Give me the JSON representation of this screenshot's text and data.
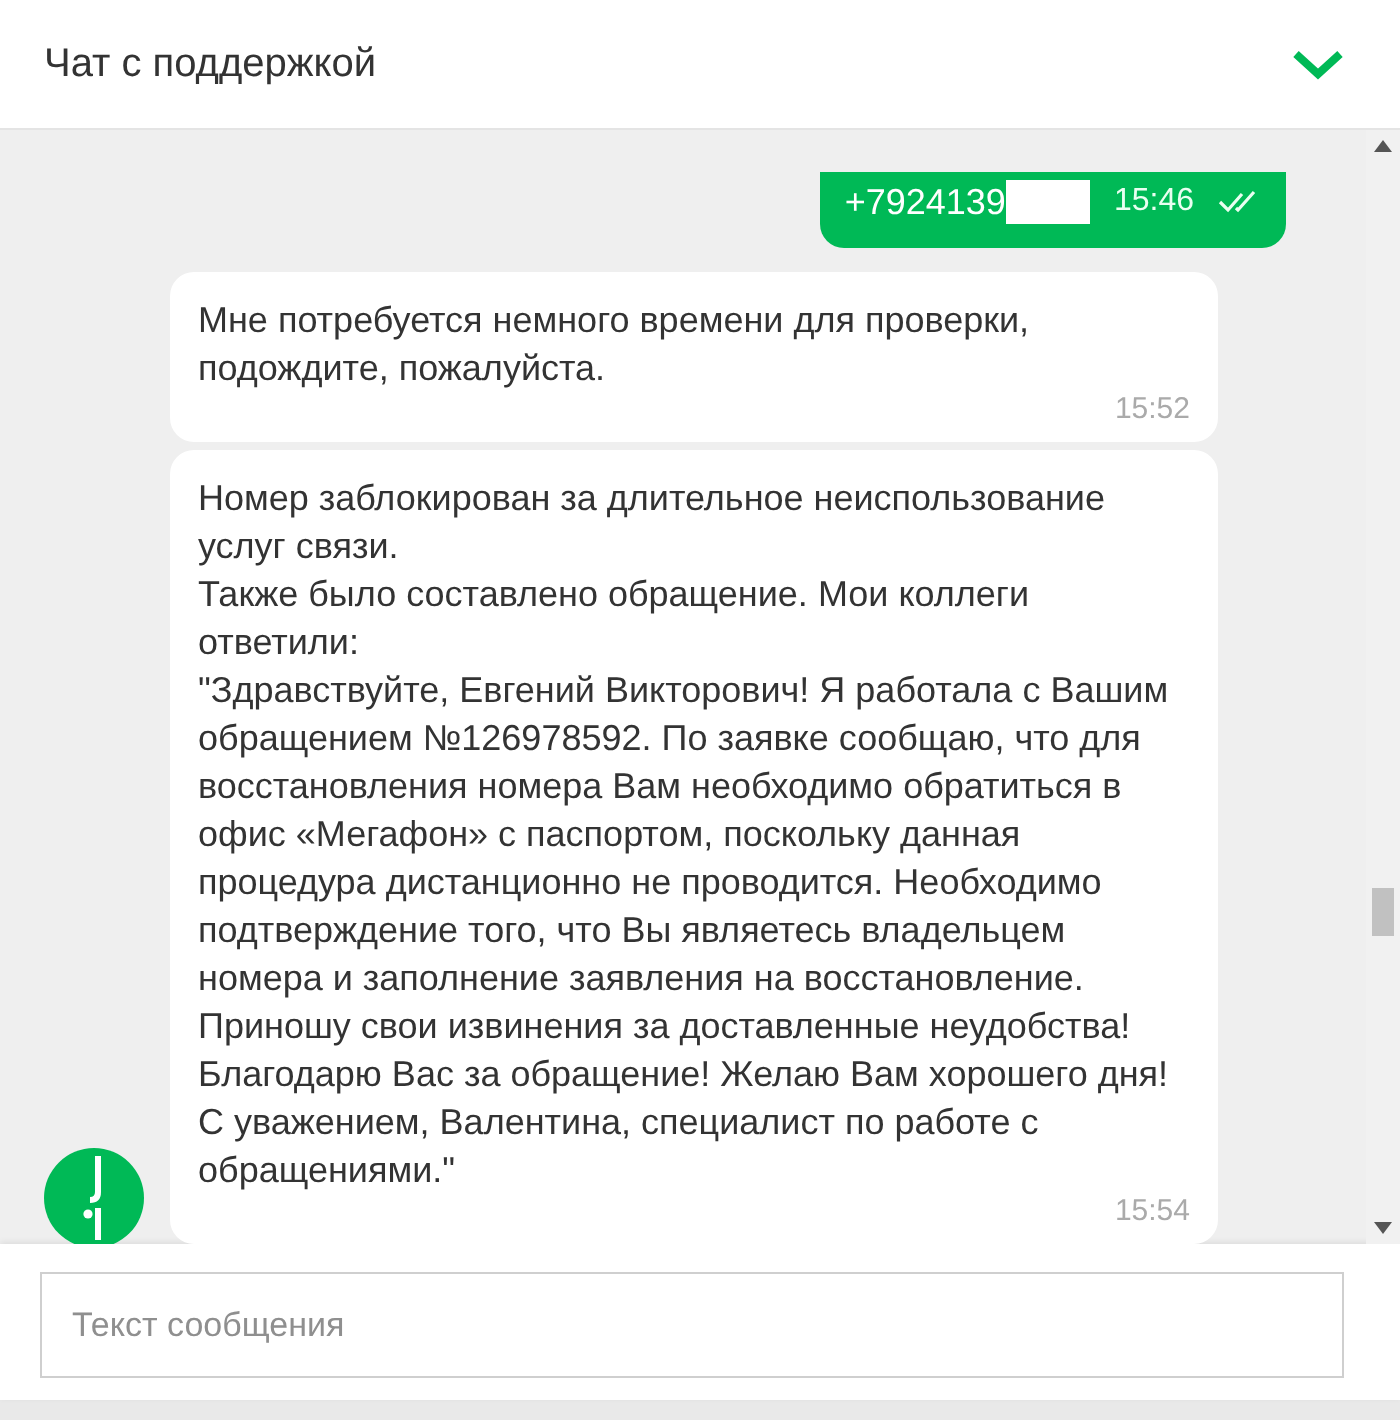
{
  "header": {
    "title": "Чат с поддержкой"
  },
  "messages": [
    {
      "kind": "outgoing",
      "text": "+7924139",
      "time": "15:46",
      "redacted": true,
      "read": true
    },
    {
      "kind": "incoming",
      "paragraphs": [
        "Мне потребуется немного времени для проверки, подождите, пожалуйста."
      ],
      "time": "15:52",
      "avatar": false
    },
    {
      "kind": "incoming",
      "paragraphs": [
        "Номер заблокирован за длительное неиспользование услуг связи.",
        "Также было составлено обращение. Мои коллеги ответили:",
        "\"Здравствуйте, Евгений Викторович! Я работала с Вашим обращением №126978592. По заявке сообщаю, что для восстановления номера Вам необходимо обратиться в офис «Мегафон» с паспортом, поскольку данная процедура дистанционно не проводится. Необходимо подтверждение того, что Вы являетесь владельцем номера и заполнение заявления на восстановление. Приношу свои извинения за доставленные неудобства! Благодарю Вас за обращение! Желаю Вам хорошего дня! С уважением, Валентина, специалист по работе с обращениями.\""
      ],
      "time": "15:54",
      "avatar": true
    }
  ],
  "composer": {
    "placeholder": "Текст сообщения"
  }
}
